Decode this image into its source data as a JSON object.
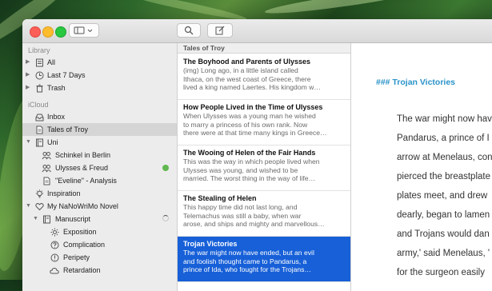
{
  "toolbar": {
    "sidebar_icon": "sidebar-icon",
    "chevron_icon": "chevron-down-icon",
    "search_icon": "search-icon",
    "compose_icon": "compose-icon"
  },
  "sidebar": {
    "library_header": "Library",
    "library_items": [
      {
        "label": "All",
        "icon": "stack-icon"
      },
      {
        "label": "Last 7 Days",
        "icon": "clock-icon"
      },
      {
        "label": "Trash",
        "icon": "trash-icon"
      }
    ],
    "icloud_header": "iCloud",
    "icloud_items": [
      {
        "label": "Inbox",
        "icon": "inbox-icon"
      },
      {
        "label": "Tales of Troy",
        "icon": "document-icon"
      },
      {
        "label": "Uni",
        "icon": "book-icon"
      },
      {
        "label": "Schinkel in Berlin",
        "icon": "group-icon"
      },
      {
        "label": "Ulysses & Freud",
        "icon": "group-icon"
      },
      {
        "label": "\"Eveline\" - Analysis",
        "icon": "document-icon"
      },
      {
        "label": "Inspiration",
        "icon": "lightbulb-icon"
      },
      {
        "label": "My NaNoWriMo Novel",
        "icon": "heart-icon"
      },
      {
        "label": "Manuscript",
        "icon": "stack-icon"
      },
      {
        "label": "Exposition",
        "icon": "sun-icon"
      },
      {
        "label": "Complication",
        "icon": "question-icon"
      },
      {
        "label": "Peripety",
        "icon": "exclamation-icon"
      },
      {
        "label": "Retardation",
        "icon": "cloud-icon"
      }
    ],
    "status_colors": {
      "sync_dot": "#62b850"
    }
  },
  "sheet_list": {
    "group_title": "Tales of Troy",
    "cards": [
      {
        "title": "The Boyhood and Parents of Ulysses",
        "lines": [
          "(img) Long ago, in a little island called",
          "Ithaca, on the west coast of Greece, there",
          "lived a king named Laertes. His kingdom w…"
        ]
      },
      {
        "title": "How People Lived in the Time of Ulysses",
        "lines": [
          "When Ulysses was a young man he wished",
          "to marry a princess of his own rank. Now",
          "there were at that time many kings in Greece…"
        ]
      },
      {
        "title": "The Wooing of Helen of the Fair Hands",
        "lines": [
          "This was the way in which people lived when",
          "Ulysses was young, and wished to be",
          "married. The worst thing in the way of life…"
        ]
      },
      {
        "title": "The Stealing of Helen",
        "lines": [
          "This happy time did not last long, and",
          "Telemachus was still a baby, when war",
          "arose, and ships and mighty and marvellous…"
        ]
      },
      {
        "title": "Trojan Victories",
        "lines": [
          "The war might now have ended, but an evil",
          "and foolish thought came to Pandarus, a",
          "prince of Ida, who fought for the Trojans…"
        ]
      }
    ],
    "accent": "#1760d8"
  },
  "editor": {
    "heading": "### Trojan Victories",
    "heading_color": "#2a93c9",
    "lines": [
      "The war might now have",
      "Pandarus, a prince of I",
      "arrow at Menelaus, con",
      "pierced the breastplate",
      "plates meet, and drew",
      "dearly, began to lamen",
      "and Trojans would dan",
      "army,' said Menelaus, '",
      "for the surgeon easily"
    ]
  }
}
